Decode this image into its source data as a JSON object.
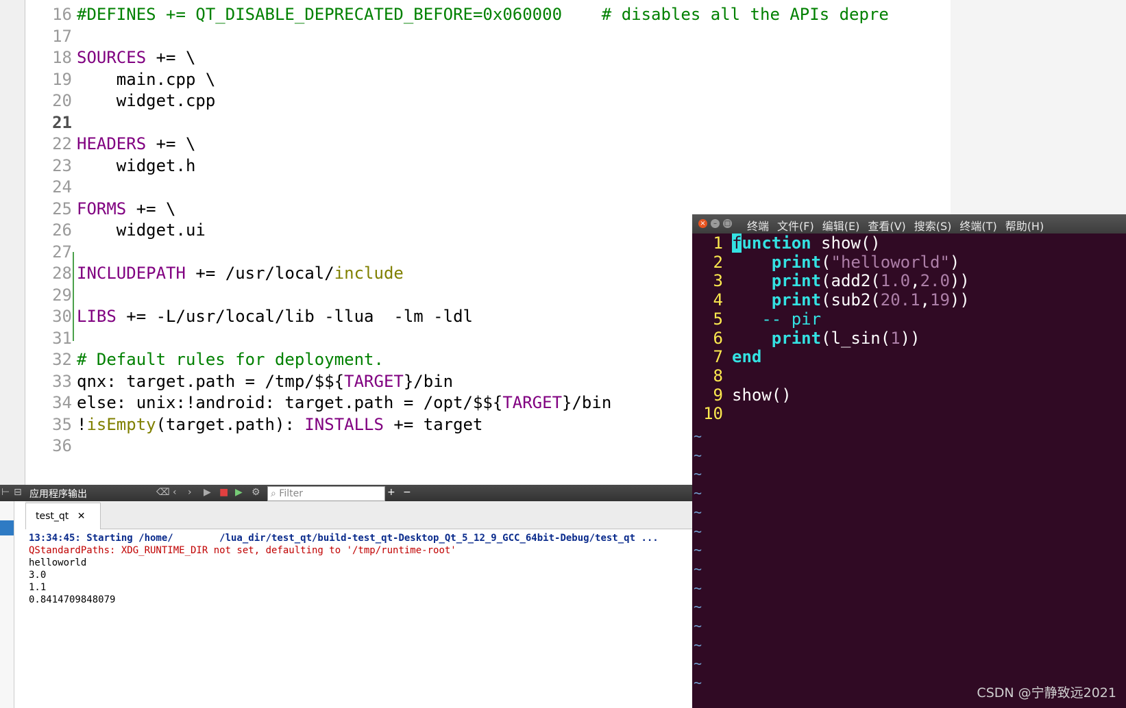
{
  "editor": {
    "lines": [
      {
        "n": "16",
        "parts": [
          [
            "cm",
            "#DEFINES += QT_DISABLE_DEPRECATED_BEFORE=0x060000    # disables all the APIs depre"
          ]
        ]
      },
      {
        "n": "17",
        "parts": []
      },
      {
        "n": "18",
        "parts": [
          [
            "kw",
            "SOURCES"
          ],
          [
            "",
            " += \\"
          ]
        ]
      },
      {
        "n": "19",
        "parts": [
          [
            "",
            "    main.cpp \\"
          ]
        ]
      },
      {
        "n": "20",
        "parts": [
          [
            "",
            "    widget.cpp"
          ]
        ]
      },
      {
        "n": "21",
        "cur": true,
        "parts": []
      },
      {
        "n": "22",
        "parts": [
          [
            "kw",
            "HEADERS"
          ],
          [
            "",
            " += \\"
          ]
        ]
      },
      {
        "n": "23",
        "parts": [
          [
            "",
            "    widget.h"
          ]
        ]
      },
      {
        "n": "24",
        "parts": []
      },
      {
        "n": "25",
        "parts": [
          [
            "kw",
            "FORMS"
          ],
          [
            "",
            " += \\"
          ]
        ]
      },
      {
        "n": "26",
        "parts": [
          [
            "",
            "    widget.ui"
          ]
        ]
      },
      {
        "n": "27",
        "parts": []
      },
      {
        "n": "28",
        "parts": [
          [
            "kw",
            "INCLUDEPATH"
          ],
          [
            "",
            " += /usr/local/"
          ],
          [
            "fn",
            "include"
          ]
        ]
      },
      {
        "n": "29",
        "parts": []
      },
      {
        "n": "30",
        "parts": [
          [
            "kw",
            "LIBS"
          ],
          [
            "",
            " += -L/usr/local/lib -llua  -lm -ldl"
          ]
        ]
      },
      {
        "n": "31",
        "parts": []
      },
      {
        "n": "32",
        "parts": [
          [
            "cm",
            "# Default rules for deployment."
          ]
        ]
      },
      {
        "n": "33",
        "parts": [
          [
            "",
            "qnx: target.path = /tmp/$${"
          ],
          [
            "kw",
            "TARGET"
          ],
          [
            "",
            "}/bin"
          ]
        ]
      },
      {
        "n": "34",
        "parts": [
          [
            "",
            "else: unix:!android: target.path = /opt/$${"
          ],
          [
            "kw",
            "TARGET"
          ],
          [
            "",
            "}/bin"
          ]
        ]
      },
      {
        "n": "35",
        "parts": [
          [
            "",
            "!"
          ],
          [
            "fn",
            "isEmpty"
          ],
          [
            "",
            "(target.path): "
          ],
          [
            "kw",
            "INSTALLS"
          ],
          [
            "",
            " += target"
          ]
        ]
      },
      {
        "n": "36",
        "parts": []
      }
    ]
  },
  "output": {
    "title": "应用程序输出",
    "filter_placeholder": "Filter",
    "tab_label": "test_qt",
    "lines": [
      {
        "text": "13:34:45: Starting /home/        /lua_dir/test_qt/build-test_qt-Desktop_Qt_5_12_9_GCC_64bit-Debug/test_qt ...",
        "color": "#0a2b8c",
        "bold": true
      },
      {
        "text": "QStandardPaths: XDG_RUNTIME_DIR not set, defaulting to '/tmp/runtime-root'",
        "color": "#c00000",
        "bold": false
      },
      {
        "text": "helloworld",
        "color": "#000000",
        "bold": false
      },
      {
        "text": "3.0",
        "color": "#000000",
        "bold": false
      },
      {
        "text": "1.1",
        "color": "#000000",
        "bold": false
      },
      {
        "text": "0.8414709848079",
        "color": "#000000",
        "bold": false
      }
    ]
  },
  "terminal": {
    "menu": [
      "终端",
      "文件(F)",
      "编辑(E)",
      "查看(V)",
      "搜索(S)",
      "终端(T)",
      "帮助(H)"
    ],
    "vim_lines": [
      {
        "n": "1",
        "parts": [
          [
            "cursor",
            "f"
          ],
          [
            "kw",
            "unction"
          ],
          [
            "",
            " show()"
          ]
        ]
      },
      {
        "n": "2",
        "parts": [
          [
            "",
            "    "
          ],
          [
            "kw",
            "print"
          ],
          [
            "",
            "("
          ],
          [
            "str",
            "\"helloworld\""
          ],
          [
            "",
            ")"
          ]
        ]
      },
      {
        "n": "3",
        "parts": [
          [
            "",
            "    "
          ],
          [
            "kw",
            "print"
          ],
          [
            "",
            "(add2("
          ],
          [
            "num",
            "1.0"
          ],
          [
            "",
            ","
          ],
          [
            "num",
            "2.0"
          ],
          [
            "",
            "))"
          ]
        ]
      },
      {
        "n": "4",
        "parts": [
          [
            "",
            "    "
          ],
          [
            "kw",
            "print"
          ],
          [
            "",
            "(sub2("
          ],
          [
            "num",
            "20.1"
          ],
          [
            "",
            ","
          ],
          [
            "num",
            "19"
          ],
          [
            "",
            "))"
          ]
        ]
      },
      {
        "n": "5",
        "parts": [
          [
            "",
            "   "
          ],
          [
            "cm",
            "-- pir"
          ]
        ]
      },
      {
        "n": "6",
        "parts": [
          [
            "",
            "    "
          ],
          [
            "kw",
            "print"
          ],
          [
            "",
            "(l_sin("
          ],
          [
            "num",
            "1"
          ],
          [
            "",
            "))"
          ]
        ]
      },
      {
        "n": "7",
        "parts": [
          [
            "kw",
            "end"
          ]
        ]
      },
      {
        "n": "8",
        "parts": []
      },
      {
        "n": "9",
        "parts": [
          [
            "",
            "show()"
          ]
        ]
      },
      {
        "n": "10",
        "parts": []
      }
    ],
    "tilde_count": 14,
    "tilde_char": "~"
  },
  "watermark": "CSDN @宁静致远2021"
}
